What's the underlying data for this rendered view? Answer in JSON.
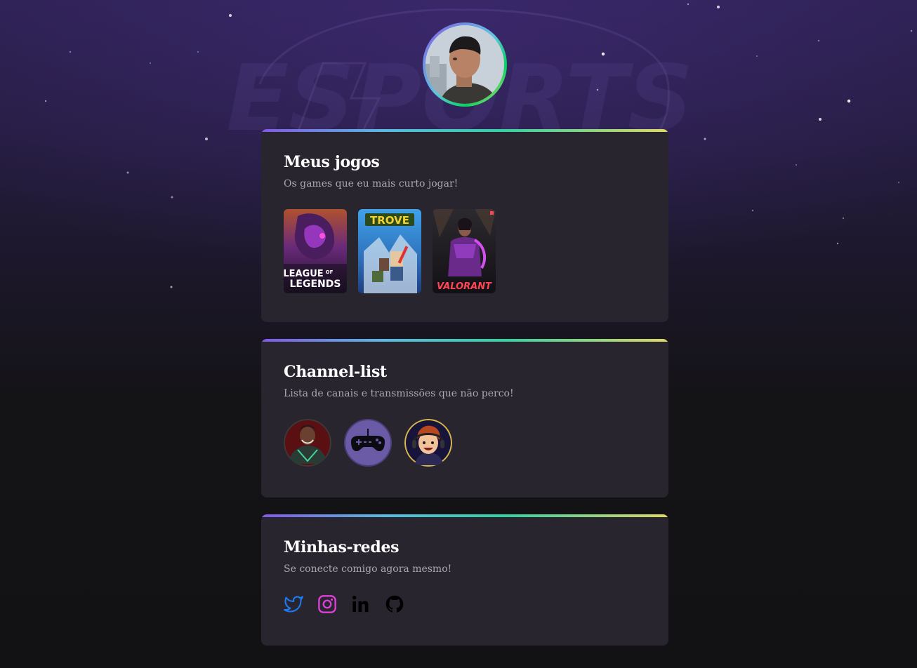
{
  "profile": {
    "avatar": "profile-photo"
  },
  "games_section": {
    "title": "Meus jogos",
    "subtitle": "Os games que eu mais curto jogar!",
    "games": [
      {
        "name": "League of Legends",
        "cover_text_1": "LEAGUE",
        "cover_text_2": "LEGENDS",
        "cover_text_of": "OF"
      },
      {
        "name": "Trove",
        "cover_text": "TROVE"
      },
      {
        "name": "Valorant",
        "cover_text": "VALORANT"
      }
    ]
  },
  "channels_section": {
    "title": "Channel-list",
    "subtitle": "Lista de canais e transmissões que não perco!",
    "channels": [
      {
        "icon": "warrior-avatar"
      },
      {
        "icon": "gamepad-icon"
      },
      {
        "icon": "cartoon-avatar"
      }
    ]
  },
  "socials_section": {
    "title": "Minhas-redes",
    "subtitle": "Se conecte comigo agora mesmo!",
    "links": [
      {
        "icon": "twitter-icon",
        "color": "#1d7af3"
      },
      {
        "icon": "instagram-icon",
        "color": "#e03fd8"
      },
      {
        "icon": "linkedin-icon",
        "color": "#000000"
      },
      {
        "icon": "github-icon",
        "color": "#000000"
      }
    ]
  },
  "colors": {
    "background": "#121214",
    "card": "#29252f",
    "accent_gradient": [
      "#8257e5",
      "#58b9e2",
      "#32d2a2",
      "#e1d863"
    ]
  }
}
